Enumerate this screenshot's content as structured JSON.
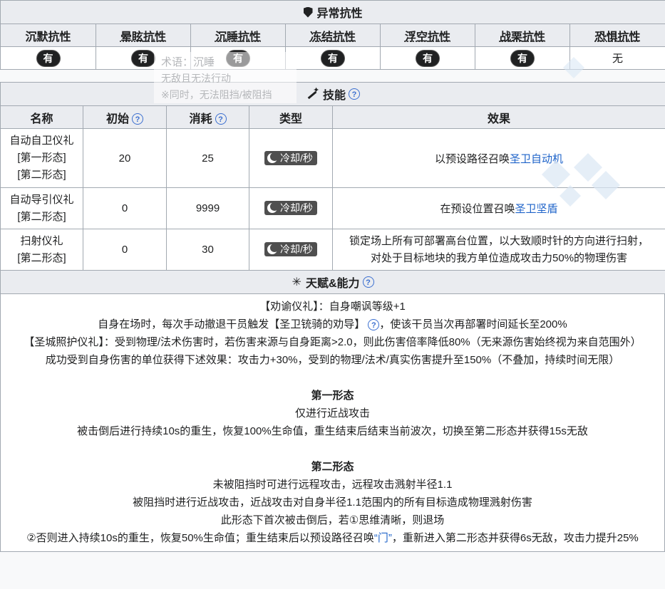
{
  "resist": {
    "title": "异常抗性",
    "headers": [
      "沉默抗性",
      "晕眩抗性",
      "沉睡抗性",
      "冻结抗性",
      "浮空抗性",
      "战栗抗性",
      "恐惧抗性"
    ],
    "values": [
      "有",
      "有",
      "有",
      "有",
      "有",
      "有",
      "无"
    ]
  },
  "tooltip": {
    "title": "术语：沉睡",
    "line1": "无敌且无法行动",
    "line2": "※同时，无法阻挡/被阻挡"
  },
  "skills": {
    "title": "技能",
    "headers": {
      "name": "名称",
      "initial": "初始",
      "cost": "消耗",
      "type": "类型",
      "effect": "效果"
    },
    "rows": [
      {
        "name": "自动自卫仪礼",
        "forms": [
          "[第一形态]",
          "[第二形态]"
        ],
        "initial": "20",
        "cost": "25",
        "type": "冷却/秒",
        "effect_text": "以预设路径召唤",
        "effect_link": "圣卫自动机"
      },
      {
        "name": "自动导引仪礼",
        "forms": [
          "[第二形态]"
        ],
        "initial": "0",
        "cost": "9999",
        "type": "冷却/秒",
        "effect_text": "在预设位置召唤",
        "effect_link": "圣卫坚盾"
      },
      {
        "name": "扫射仪礼",
        "forms": [
          "[第二形态]"
        ],
        "initial": "0",
        "cost": "30",
        "type": "冷却/秒",
        "effect_line1": "锁定场上所有可部署高台位置，以大致顺时针的方向进行扫射，",
        "effect_line2": "对处于目标地块的我方单位造成攻击力50%的物理伤害"
      }
    ]
  },
  "talent": {
    "title": "天赋&能力",
    "l1": "【劝谕仪礼】：自身嘲讽等级+1",
    "l2a": "自身在场时，每次手动撤退干员触发【圣卫铳骑的劝导】",
    "l2b": "，使该干员当次再部署时间延长至200%",
    "l3": "【圣城照护仪礼】：受到物理/法术伤害时，若伤害来源与自身距离>2.0，则此伤害倍率降低80%（无来源伤害始终视为来自范围外）",
    "l4": "成功受到自身伤害的单位获得下述效果：攻击力+30%，受到的物理/法术/真实伤害提升至150%（不叠加，持续时间无限）",
    "form1_title": "第一形态",
    "form1_l1": "仅进行近战攻击",
    "form1_l2": "被击倒后进行持续10s的重生，恢复100%生命值，重生结束后结束当前波次，切换至第二形态并获得15s无敌",
    "form2_title": "第二形态",
    "form2_l1": "未被阻挡时可进行远程攻击，远程攻击溅射半径1.1",
    "form2_l2": "被阻挡时进行近战攻击，近战攻击对自身半径1.1范围内的所有目标造成物理溅射伤害",
    "form2_l3": "此形态下首次被击倒后，若①思维清晰，则退场",
    "form2_l4a": "②否则进入持续10s的重生，恢复50%生命值；重生结束后以预设路径召唤",
    "form2_l4link": "“门”",
    "form2_l4b": "，重新进入第二形态并获得6s无敌，攻击力提升25%"
  },
  "icons": {
    "resist": "shield-icon",
    "skills": "magic-wand-icon",
    "talent": "sparkle-icon",
    "help": "question-circle-icon",
    "cooldown": "moon-icon"
  },
  "colors": {
    "header_bg": "#eaecf0",
    "border": "#a2a9b1",
    "link": "#1e63c9",
    "pill": "#202122",
    "tag": "#4f4f4f"
  }
}
